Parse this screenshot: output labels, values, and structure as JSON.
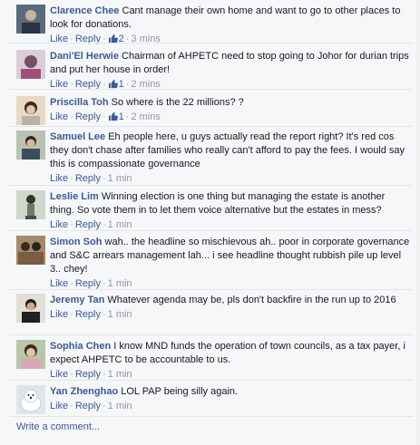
{
  "comments": [
    {
      "author": "Clarence Chee",
      "text": "Cant manage their own home and want to go to other places to look for donations.",
      "like": "Like",
      "reply": "Reply",
      "likes": "2",
      "time": "3 mins",
      "avatar_icon": "person-avatar-icon"
    },
    {
      "author": "Dani'El Herwie",
      "text": "Chairman of AHPETC need to stop going to Johor for durian trips and put her house in order!",
      "like": "Like",
      "reply": "Reply",
      "likes": "1",
      "time": "2 mins",
      "avatar_icon": "person-avatar-icon"
    },
    {
      "author": "Priscilla Toh",
      "text": "So where is the 22 millions? ?",
      "like": "Like",
      "reply": "Reply",
      "likes": "1",
      "time": "2 mins",
      "avatar_icon": "person-avatar-icon"
    },
    {
      "author": "Samuel Lee",
      "text": "Eh people here, u guys actually read the report right? It's red cos they don't chase after families who really can't afford to pay the fees. I would say this is compassionate governance",
      "like": "Like",
      "reply": "Reply",
      "likes": "",
      "time": "1 min",
      "avatar_icon": "person-avatar-icon"
    },
    {
      "author": "Leslie Lim",
      "text": "Winning election is one thing but managing the estate is another thing. So vote them in to let them voice alternative but the estates in mess?",
      "like": "Like",
      "reply": "Reply",
      "likes": "",
      "time": "1 min",
      "avatar_icon": "person-avatar-icon"
    },
    {
      "author": "Simon Soh",
      "text": "wah.. the headline so mischievous ah.. poor in corporate governance and S&C arrears management lah... i see headline thought rubbish pile up level 3.. chey!",
      "like": "Like",
      "reply": "Reply",
      "likes": "",
      "time": "1 min",
      "avatar_icon": "person-avatar-icon"
    },
    {
      "author": "Jeremy Tan",
      "text": "Whatever agenda may be, pls don't backfire in the run up to 2016",
      "like": "Like",
      "reply": "Reply",
      "likes": "",
      "time": "1 min",
      "avatar_icon": "person-avatar-icon"
    },
    {
      "author": "Sophia Chen",
      "text": "I know MND funds the operation of town councils, as a tax payer, i expect AHPETC to be accountable to us.",
      "like": "Like",
      "reply": "Reply",
      "likes": "",
      "time": "1 min",
      "avatar_icon": "person-avatar-icon"
    },
    {
      "author": "Yan Zhenghao",
      "text": "LOL PAP being silly again.",
      "like": "Like",
      "reply": "Reply",
      "likes": "",
      "time": "1 min",
      "avatar_icon": "polar-bear-avatar-icon"
    }
  ],
  "write_comment": "Write a comment...",
  "colors": {
    "link": "#3b5998",
    "meta": "#9197a3",
    "background": "#f6f7f9"
  }
}
